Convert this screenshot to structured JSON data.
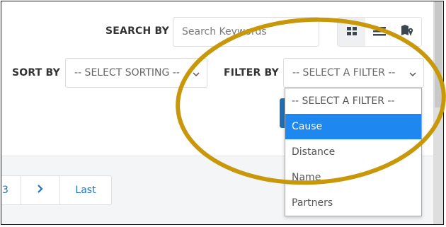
{
  "search": {
    "label": "SEARCH BY",
    "placeholder": "Search Keywords"
  },
  "view_toggle": {
    "buttons": [
      {
        "icon": "grid-icon",
        "active": true
      },
      {
        "icon": "list-icon",
        "active": false
      },
      {
        "icon": "map-icon",
        "active": false
      }
    ]
  },
  "sort": {
    "label": "SORT BY",
    "selected": "-- SELECT SORTING --"
  },
  "filter": {
    "label": "FILTER BY",
    "selected": "-- SELECT A FILTER --",
    "options": [
      {
        "label": "-- SELECT A FILTER --",
        "highlighted": false
      },
      {
        "label": "Cause",
        "highlighted": true
      },
      {
        "label": "Distance",
        "highlighted": false
      },
      {
        "label": "Name",
        "highlighted": false
      },
      {
        "label": "Partners",
        "highlighted": false
      }
    ]
  },
  "pagination": {
    "page": "3",
    "next_icon": "chevron-right-icon",
    "last": "Last"
  },
  "colors": {
    "accent": "#1e88f0",
    "link": "#1e73be",
    "annotation": "#c9980a"
  }
}
